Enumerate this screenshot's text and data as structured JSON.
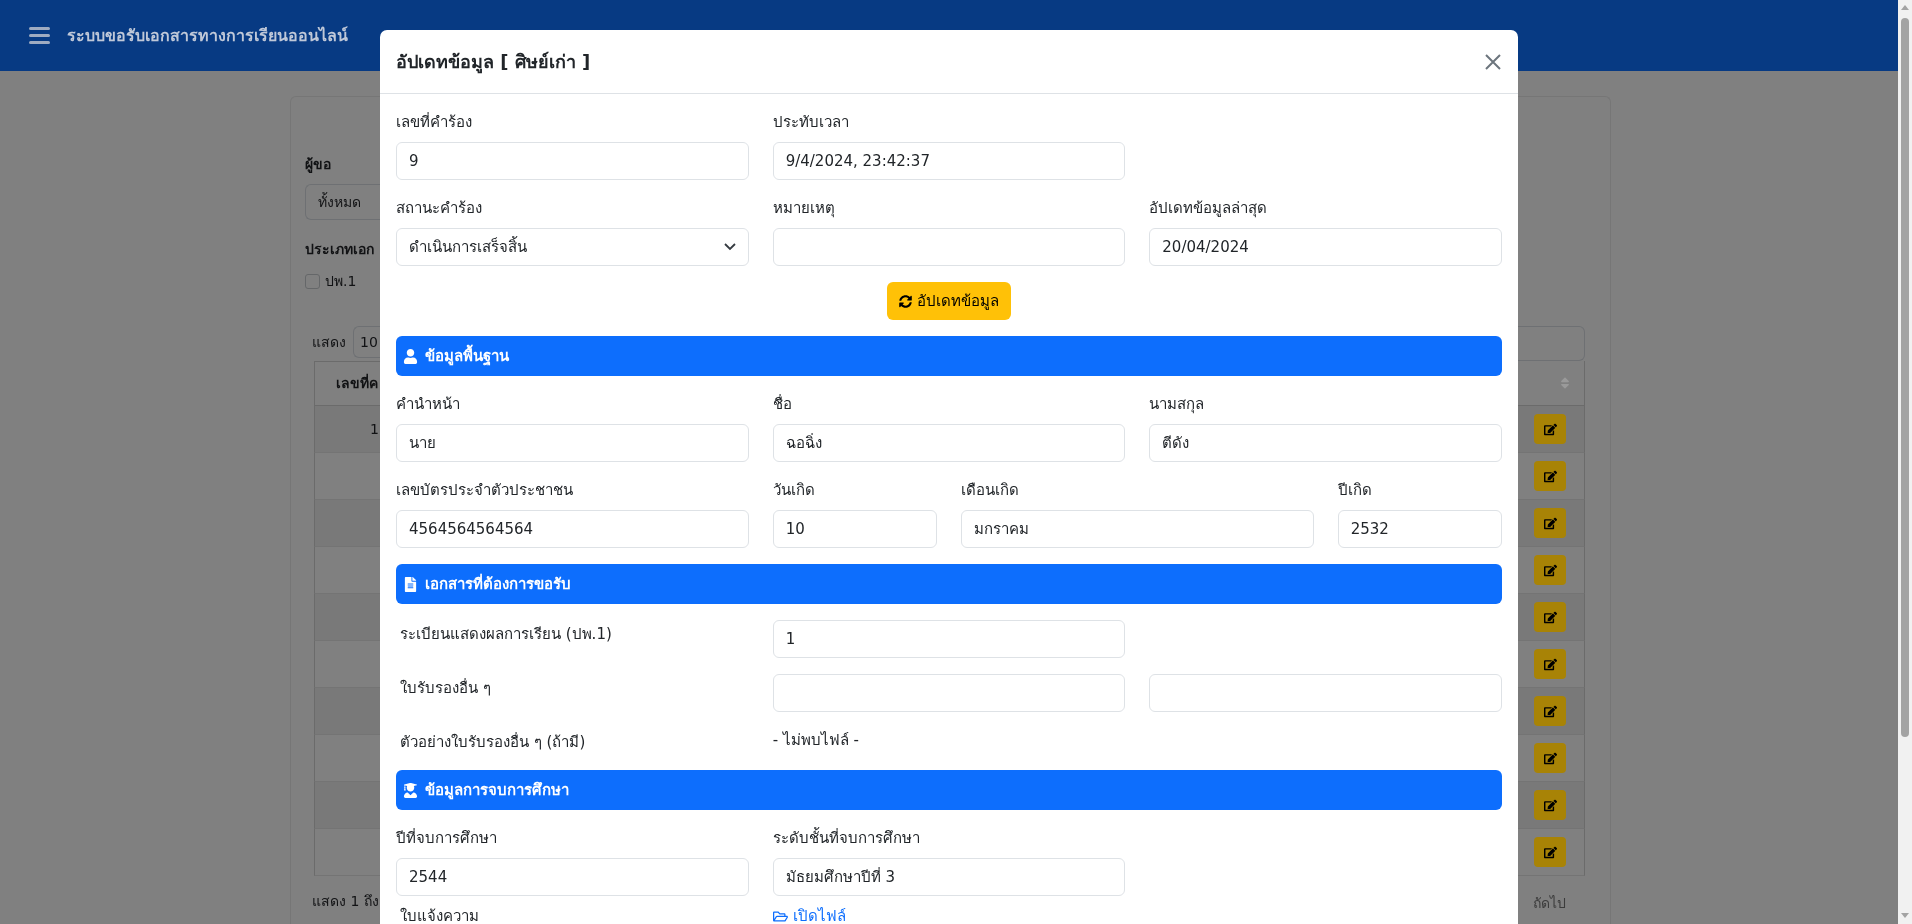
{
  "header": {
    "title": "ระบบขอรับเอกสารทางการเรียนออนไลน์"
  },
  "filters": {
    "requester": {
      "label": "ผู้ขอ",
      "value": "ทั้งหมด"
    },
    "document_type": {
      "label": "ประเภทเอก",
      "options": [
        {
          "label": "ปพ.1",
          "checked": false
        }
      ]
    }
  },
  "table": {
    "length": {
      "label": "แสดง",
      "value": "10"
    },
    "columns": [
      {
        "label": "เลขที่ค"
      }
    ],
    "rows": [
      {
        "column_1": "1"
      },
      {},
      {},
      {},
      {},
      {},
      {},
      {},
      {},
      {}
    ],
    "info": "แสดง 1 ถึง",
    "next": "ถัดไป"
  },
  "modal": {
    "title": "อัปเดทข้อมูล [ ศิษย์เก่า ]",
    "request": {
      "number": {
        "label": "เลขที่คำร้อง",
        "value": "9"
      },
      "timestamp": {
        "label": "ประทับเวลา",
        "value": "9/4/2024, 23:42:37"
      },
      "status": {
        "label": "สถานะคำร้อง",
        "value": "ดำเนินการเสร็จสิ้น"
      },
      "note": {
        "label": "หมายเหตุ"
      },
      "last_update": {
        "label": "อัปเดทข้อมูลล่าสุด",
        "value": "20/04/2024"
      }
    },
    "update_button": "อัปเดทข้อมูล",
    "sections": [
      {
        "kind": "personal",
        "title": "ข้อมูลพื้นฐาน",
        "fields": [
          {
            "label": "คำนำหน้า",
            "value": "นาย"
          },
          {
            "label": "ชื่อ",
            "value": "ฉอฉิ่ง"
          },
          {
            "label": "นามสกุล",
            "value": "ตีดัง"
          },
          {
            "label": "เลขบัตรประจำตัวประชาชน",
            "value": "4564564564564"
          },
          {
            "label": "วันเกิด",
            "value": "10"
          },
          {
            "label": "เดือนเกิด",
            "value": "มกราคม"
          },
          {
            "label": "ปีเกิด",
            "value": "2532"
          }
        ]
      },
      {
        "kind": "documents",
        "title": "เอกสารที่ต้องการขอรับ",
        "rows": [
          {
            "kind": "input",
            "label": "ระเบียนแสดงผลการเรียน (ปพ.1)",
            "value": "1"
          },
          {
            "kind": "input_pair",
            "label": "ใบรับรองอื่น ๆ"
          },
          {
            "kind": "file",
            "label": "ตัวอย่างใบรับรองอื่น ๆ (ถ้ามี)",
            "text": "- ไม่พบไฟล์ -"
          }
        ]
      },
      {
        "kind": "graduation",
        "title": "ข้อมูลการจบการศึกษา",
        "fields": [
          {
            "label": "ปีที่จบการศึกษา",
            "value": "2544"
          },
          {
            "label": "ระดับชั้นที่จบการศึกษา",
            "value": "มัธยมศึกษาปีที่ 3"
          }
        ],
        "rows": [
          {
            "kind": "link",
            "label": "ใบแจ้งความ",
            "link": "เปิดไฟล์"
          }
        ]
      }
    ]
  }
}
